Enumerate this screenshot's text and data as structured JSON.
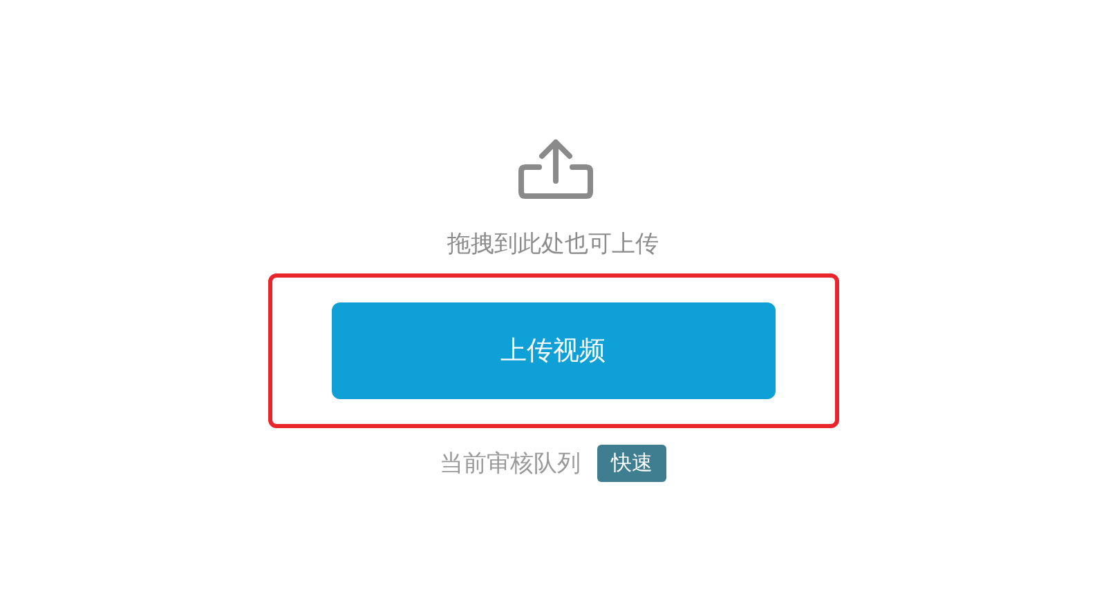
{
  "upload": {
    "hint": "拖拽到此处也可上传",
    "button": {
      "label": "上传视频",
      "highlighted": true
    }
  },
  "queue": {
    "label": "当前审核队列",
    "badge": "快速"
  }
}
